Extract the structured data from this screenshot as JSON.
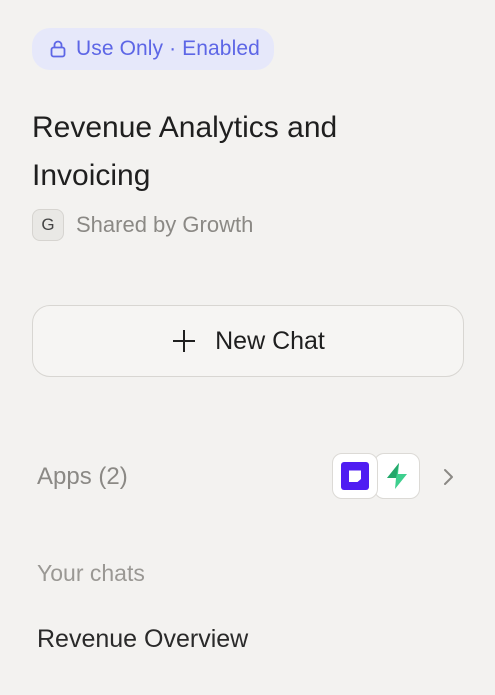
{
  "badge": {
    "label": "Use Only · Enabled",
    "color": "#5d66e6",
    "background": "#e6e8fa",
    "icon": "lock-icon"
  },
  "project": {
    "title": "Revenue Analytics and Invoicing",
    "owner_initial": "G",
    "shared_by": "Shared by Growth"
  },
  "actions": {
    "new_chat_label": "New Chat",
    "new_chat_icon": "plus-icon"
  },
  "apps": {
    "label": "Apps (2)",
    "items": [
      {
        "name": "app-purple-square-icon",
        "color": "#4f1df2"
      },
      {
        "name": "app-green-bolt-icon",
        "color": "#3ecf8e"
      }
    ]
  },
  "chats": {
    "heading": "Your chats",
    "items": [
      {
        "title": "Revenue Overview"
      }
    ]
  }
}
